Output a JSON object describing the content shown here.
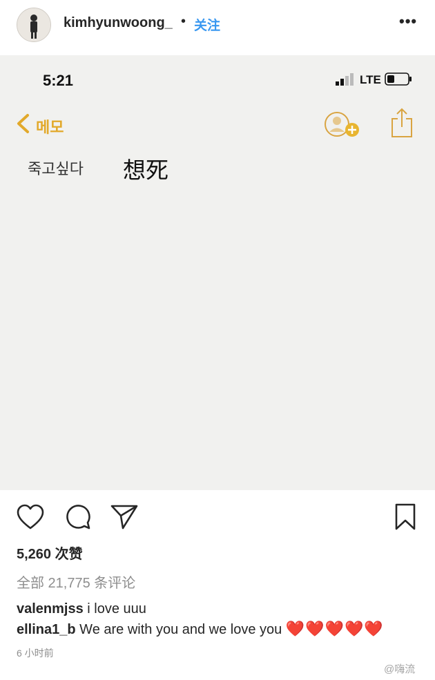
{
  "header": {
    "username": "kimhyunwoong_",
    "separator": "•",
    "follow_label": "关注",
    "more_label": "•••"
  },
  "phone": {
    "time": "5:21",
    "network": "LTE",
    "back_label": "메모",
    "note_korean": "죽고싶다",
    "note_chinese": "想死",
    "accent_color": "#e2a92b"
  },
  "post": {
    "likes": "5,260 次赞",
    "all_comments": "全部 21,775 条评论",
    "comments": [
      {
        "user": "valenmjss",
        "text": "i love uuu",
        "hearts": ""
      },
      {
        "user": "ellina1_b",
        "text": "We are with you and we love you",
        "hearts": "❤️❤️❤️❤️❤️"
      }
    ],
    "time_ago": "6 小时前"
  },
  "watermark": "@嗨流"
}
